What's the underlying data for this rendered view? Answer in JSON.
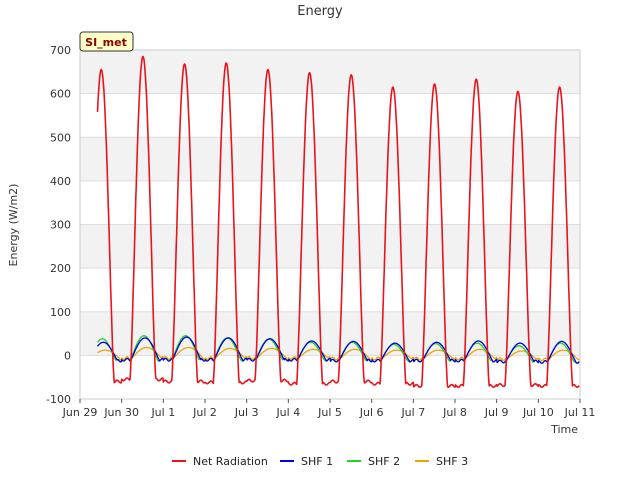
{
  "chart_data": {
    "type": "line",
    "title": "Energy",
    "xlabel": "Time",
    "ylabel": "Energy (W/m2)",
    "badge": "SI_met",
    "xlim": [
      0,
      12
    ],
    "ylim": [
      -100,
      700
    ],
    "grid": true,
    "legend_position": "bottom-center",
    "x_ticks": [
      {
        "x": 0,
        "label": "Jun 29"
      },
      {
        "x": 1,
        "label": "Jun 30"
      },
      {
        "x": 2,
        "label": "Jul 1"
      },
      {
        "x": 3,
        "label": "Jul 2"
      },
      {
        "x": 4,
        "label": "Jul 3"
      },
      {
        "x": 5,
        "label": "Jul 4"
      },
      {
        "x": 6,
        "label": "Jul 5"
      },
      {
        "x": 7,
        "label": "Jul 6"
      },
      {
        "x": 8,
        "label": "Jul 7"
      },
      {
        "x": 9,
        "label": "Jul 8"
      },
      {
        "x": 10,
        "label": "Jul 9"
      },
      {
        "x": 11,
        "label": "Jul 10"
      },
      {
        "x": 12,
        "label": "Jul 11"
      }
    ],
    "y_ticks": [
      -100,
      0,
      100,
      200,
      300,
      400,
      500,
      600,
      700
    ],
    "daily_cycle": {
      "days": [
        "Jun 29",
        "Jun 30",
        "Jul 1",
        "Jul 2",
        "Jul 3",
        "Jul 4",
        "Jul 5",
        "Jul 6",
        "Jul 7",
        "Jul 8",
        "Jul 9",
        "Jul 10"
      ],
      "net_radiation_peak": [
        655,
        685,
        668,
        670,
        655,
        648,
        643,
        615,
        622,
        633,
        605,
        615
      ],
      "net_radiation_night": [
        -60,
        -55,
        -60,
        -62,
        -58,
        -65,
        -60,
        -65,
        -70,
        -70,
        -68,
        -70
      ],
      "shf1_peak": [
        30,
        40,
        42,
        40,
        38,
        33,
        32,
        28,
        30,
        33,
        28,
        32
      ],
      "shf2_peak": [
        38,
        45,
        45,
        40,
        37,
        30,
        30,
        25,
        27,
        28,
        22,
        28
      ],
      "shf3_peak": [
        12,
        18,
        18,
        16,
        16,
        14,
        14,
        12,
        12,
        14,
        10,
        12
      ],
      "shf_night": [
        -12,
        -10,
        -10,
        -10,
        -10,
        -10,
        -12,
        -12,
        -12,
        -12,
        -14,
        -15
      ]
    },
    "series": [
      {
        "name": "Net Radiation",
        "color": "#e8141c"
      },
      {
        "name": "SHF 1",
        "color": "#0000e6"
      },
      {
        "name": "SHF 2",
        "color": "#1ed41e"
      },
      {
        "name": "SHF 3",
        "color": "#f0a400"
      }
    ]
  }
}
